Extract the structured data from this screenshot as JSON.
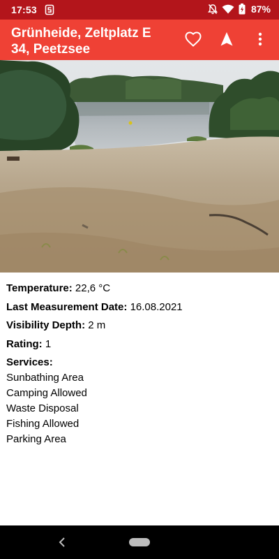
{
  "status_bar": {
    "time": "17:53",
    "battery": "87%",
    "icons": [
      "app-notification-icon",
      "bell-off-icon",
      "wifi-icon",
      "battery-icon"
    ]
  },
  "app_bar": {
    "title": "Grünheide, Zeltplatz E 34, Peetzsee",
    "actions": [
      "heart-icon",
      "navigation-arrow-icon",
      "more-vert-icon"
    ],
    "colors": {
      "background": "#ef4135",
      "status_bar": "#b3151b"
    }
  },
  "details": {
    "temperature_label": "Temperature:",
    "temperature_value": "22,6 °C",
    "date_label": "Last Measurement Date:",
    "date_value": "16.08.2021",
    "visibility_label": "Visibility Depth:",
    "visibility_value": "2 m",
    "rating_label": "Rating:",
    "rating_value": "1",
    "services_label": "Services:",
    "services": [
      "Sunbathing Area",
      "Camping Allowed",
      "Waste Disposal",
      "Fishing Allowed",
      "Parking Area"
    ]
  }
}
